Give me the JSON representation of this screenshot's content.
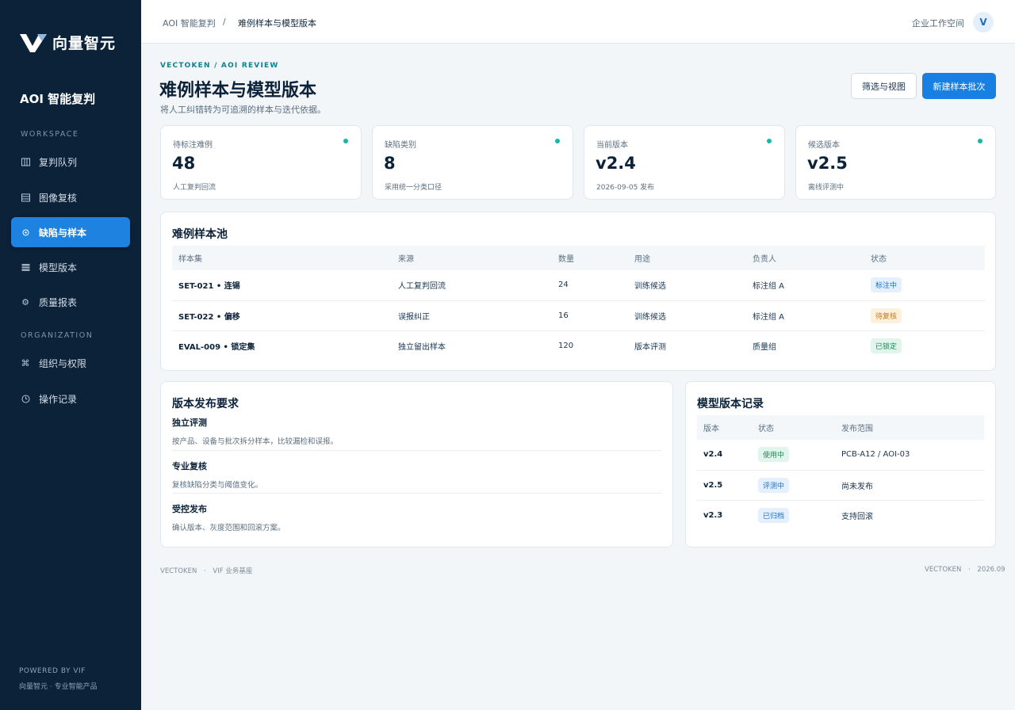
{
  "sidebar": {
    "brand": "向量智元",
    "app_name": "AOI 智能复判",
    "workspace_label": "WORKSPACE",
    "organization_label": "ORGANIZATION",
    "workspace_items": [
      {
        "label": "复判队列",
        "icon": "columns-icon"
      },
      {
        "label": "图像复核",
        "icon": "image-list-icon"
      },
      {
        "label": "缺陷与样本",
        "icon": "target-icon",
        "active": true
      },
      {
        "label": "模型版本",
        "icon": "grid-icon"
      },
      {
        "label": "质量报表",
        "icon": "gear-icon"
      }
    ],
    "org_items": [
      {
        "label": "组织与权限",
        "icon": "command-icon"
      },
      {
        "label": "操作记录",
        "icon": "clock-icon"
      }
    ],
    "powered_by": "POWERED BY VIF",
    "powered_sub": "向量智元 · 专业智能产品"
  },
  "topbar": {
    "breadcrumb_root": "AOI 智能复判",
    "breadcrumb_sep": "/",
    "breadcrumb_current": "难例样本与模型版本",
    "workspace": "企业工作空间",
    "avatar": "V"
  },
  "header": {
    "eyebrow": "VECTOKEN / AOI REVIEW",
    "title": "难例样本与模型版本",
    "subtitle": "将人工纠错转为可追溯的样本与迭代依据。",
    "filter_button": "筛选与视图",
    "new_button": "新建样本批次"
  },
  "stats": [
    {
      "label": "待标注难例",
      "value": "48",
      "hint": "人工复判回流"
    },
    {
      "label": "缺陷类别",
      "value": "8",
      "hint": "采用统一分类口径"
    },
    {
      "label": "当前版本",
      "value": "v2.4",
      "hint": "2026-09-05 发布"
    },
    {
      "label": "候选版本",
      "value": "v2.5",
      "hint": "离线评测中"
    }
  ],
  "pool": {
    "title": "难例样本池",
    "columns": [
      "样本集",
      "来源",
      "数量",
      "用途",
      "负责人",
      "状态"
    ],
    "rows": [
      {
        "set": "SET-021 • 连锡",
        "source": "人工复判回流",
        "count": "24",
        "usage": "训练候选",
        "owner": "标注组 A",
        "status": "标注中",
        "status_color": "#1d6fc2"
      },
      {
        "set": "SET-022 • 偏移",
        "source": "误报纠正",
        "count": "16",
        "usage": "训练候选",
        "owner": "标注组 A",
        "status": "待复核",
        "status_color": "#c67b14"
      },
      {
        "set": "EVAL-009 • 锁定集",
        "source": "独立留出样本",
        "count": "120",
        "usage": "版本评测",
        "owner": "质量组",
        "status": "已锁定",
        "status_color": "#1c8a56"
      }
    ]
  },
  "requirements": {
    "title": "版本发布要求",
    "items": [
      {
        "title": "独立评测",
        "desc": "按产品、设备与批次拆分样本，比较漏检和误报。"
      },
      {
        "title": "专业复核",
        "desc": "复核缺陷分类与阈值变化。"
      },
      {
        "title": "受控发布",
        "desc": "确认版本、灰度范围和回滚方案。"
      }
    ]
  },
  "versions": {
    "title": "模型版本记录",
    "columns": [
      "版本",
      "状态",
      "发布范围"
    ],
    "rows": [
      {
        "version": "v2.4",
        "status": "使用中",
        "scope": "PCB-A12 / AOI-03",
        "status_color": "#1c8a56"
      },
      {
        "version": "v2.5",
        "status": "评测中",
        "scope": "尚未发布",
        "status_color": "#1d6fc2"
      },
      {
        "version": "v2.3",
        "status": "已归档",
        "scope": "支持回滚",
        "status_color": "#1d6fc2"
      }
    ]
  },
  "footer": {
    "left_brand": "VECTOKEN",
    "left_sep": "·",
    "left_label": "VIF 业务基座",
    "right_brand": "VECTOKEN",
    "right_sep": "·",
    "right_date": "2026.09"
  }
}
